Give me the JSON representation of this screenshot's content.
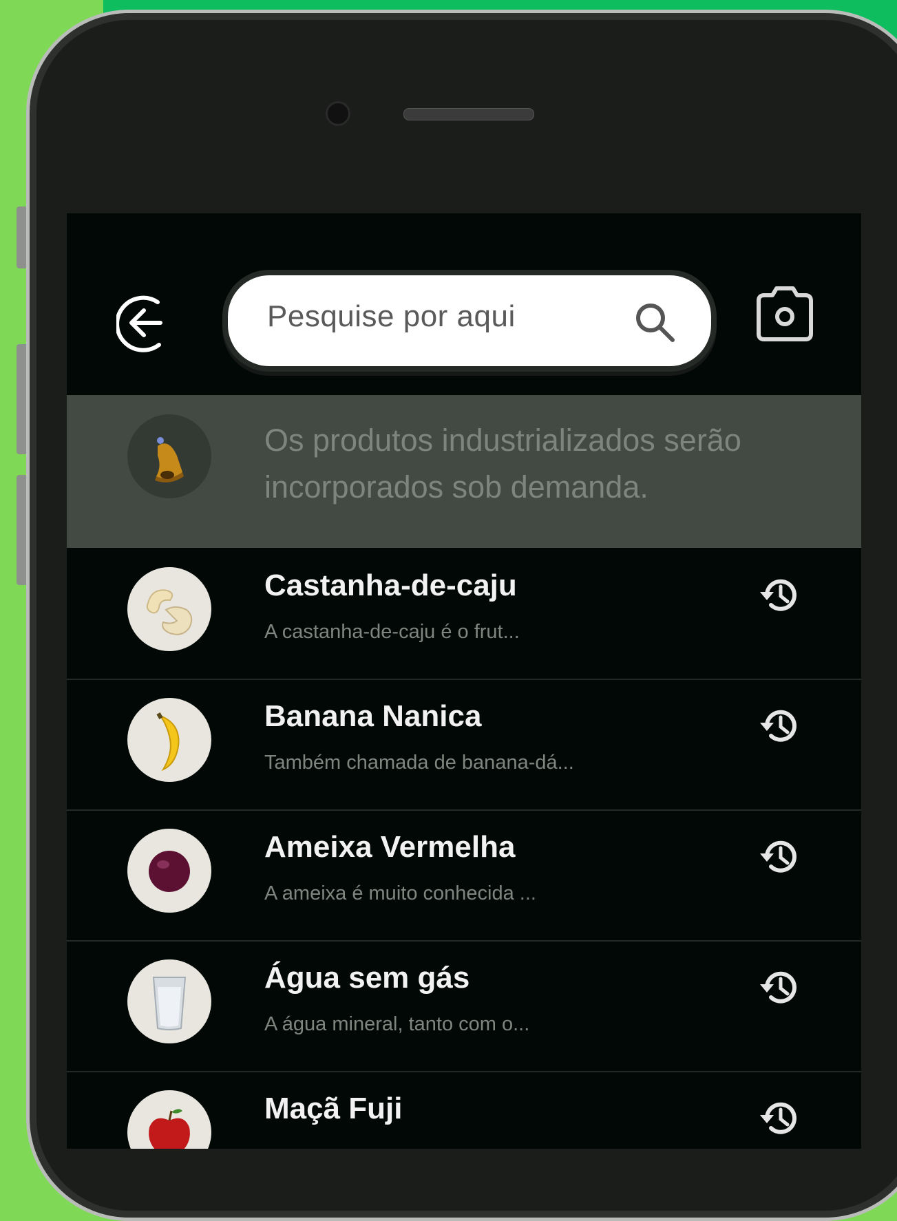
{
  "search": {
    "placeholder": "Pesquise por aqui"
  },
  "notice": {
    "text": "Os produtos industrializados serão incorporados sob demanda."
  },
  "items": [
    {
      "name": "Castanha-de-caju",
      "description": "A castanha-de-caju é o frut...",
      "icon": "cashew"
    },
    {
      "name": "Banana Nanica",
      "description": "Também chamada de banana-dá...",
      "icon": "banana"
    },
    {
      "name": "Ameixa Vermelha",
      "description": "A ameixa é muito conhecida ...",
      "icon": "plum"
    },
    {
      "name": "Água sem gás",
      "description": "A água mineral, tanto com o...",
      "icon": "water-glass"
    },
    {
      "name": "Maçã Fuji",
      "description": "",
      "icon": "apple"
    }
  ],
  "colors": {
    "screen_bg": "#020806",
    "notice_bg": "#434a44",
    "accent_green": "#0ebd5e",
    "light_green": "#7fd957"
  }
}
